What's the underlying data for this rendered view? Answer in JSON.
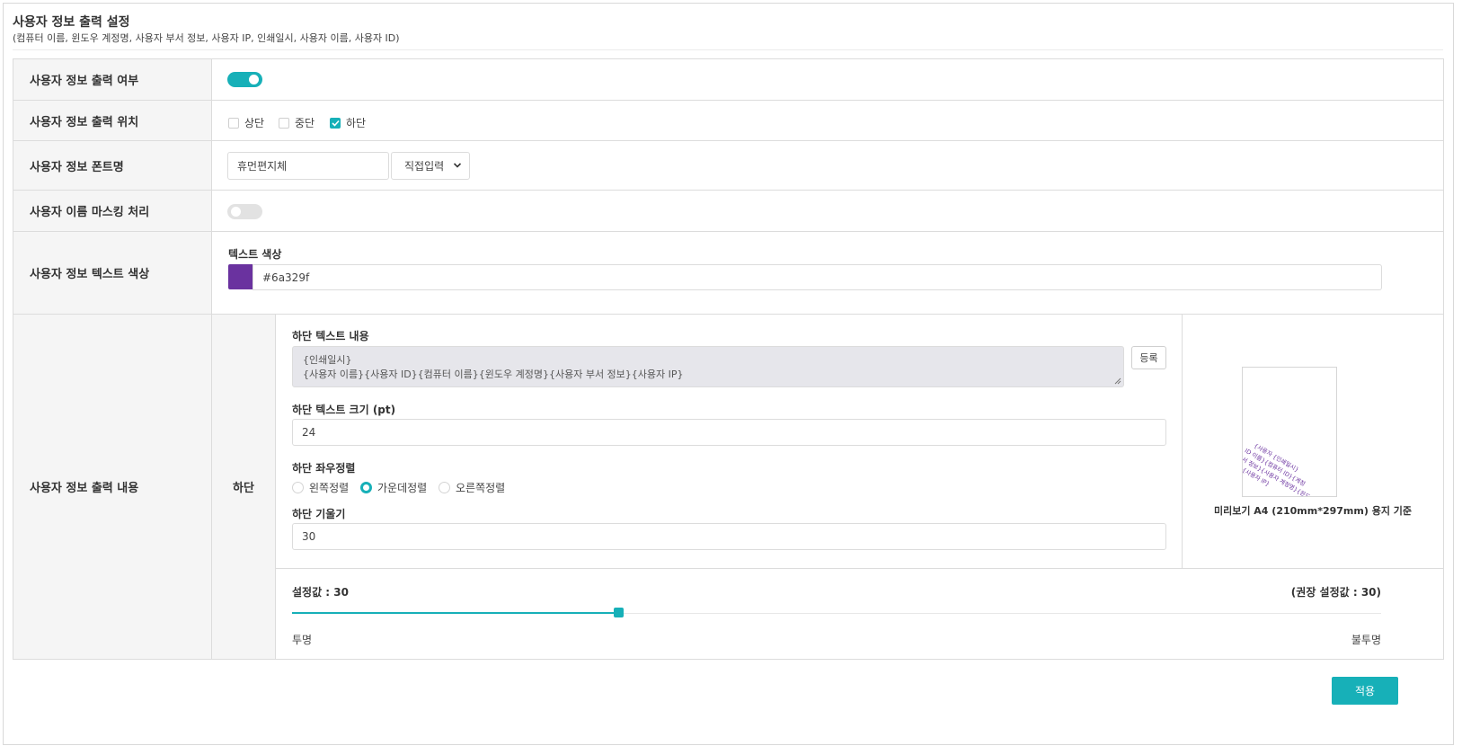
{
  "header": {
    "title": "사용자 정보 출력 설정",
    "subtitle": "(컴퓨터 이름, 윈도우 계정명, 사용자 부서 정보, 사용자 IP, 인쇄일시, 사용자 이름, 사용자 ID)"
  },
  "rows": {
    "output_enable": {
      "label": "사용자 정보 출력 여부",
      "enabled": true
    },
    "position": {
      "label": "사용자 정보 출력 위치",
      "options": [
        {
          "label": "상단",
          "checked": false
        },
        {
          "label": "중단",
          "checked": false
        },
        {
          "label": "하단",
          "checked": true
        }
      ]
    },
    "font": {
      "label": "사용자 정보 폰트명",
      "value": "휴먼편지체",
      "select_value": "직접입력"
    },
    "masking": {
      "label": "사용자 이름 마스킹 처리",
      "enabled": false
    },
    "color": {
      "label": "사용자 정보 텍스트 색상",
      "sublabel": "텍스트 색상",
      "value": "#6a329f",
      "swatch_color": "#6a329f"
    },
    "content": {
      "label": "사용자 정보 출력 내용",
      "section": "하단",
      "text_label": "하단 텍스트 내용",
      "text_line1": "{인쇄일시}",
      "text_line2": "{사용자 이름}{사용자 ID}{컴퓨터 이름}{윈도우 계정명}{사용자 부서 정보}{사용자 IP}",
      "register_button": "등록",
      "size_label": "하단 텍스트 크기 (pt)",
      "size_value": "24",
      "align_label": "하단 좌우정렬",
      "align_options": [
        {
          "label": "왼쪽정렬",
          "selected": false
        },
        {
          "label": "가운데정렬",
          "selected": true
        },
        {
          "label": "오른쪽정렬",
          "selected": false
        }
      ],
      "tilt_label": "하단 기울기",
      "tilt_value": "30",
      "preview_caption": "미리보기 A4 (210mm*297mm) 용지 기준",
      "preview_lines": [
        "{사용자 {인쇄일시}",
        "ID 이름}{컴퓨터 ID}{계정",
        "부서 정보}{사용자 계정명}{윈도우",
        "정보}{사용자 IP}"
      ]
    },
    "slider": {
      "setting_label": "설정값 : 30",
      "recommended_label": "(권장 설정값 : 30)",
      "min_label": "투명",
      "max_label": "불투명",
      "value_fraction": 0.3
    }
  },
  "apply_button": "적용",
  "colors": {
    "accent": "#17b0b8",
    "text_color": "#6a329f"
  }
}
